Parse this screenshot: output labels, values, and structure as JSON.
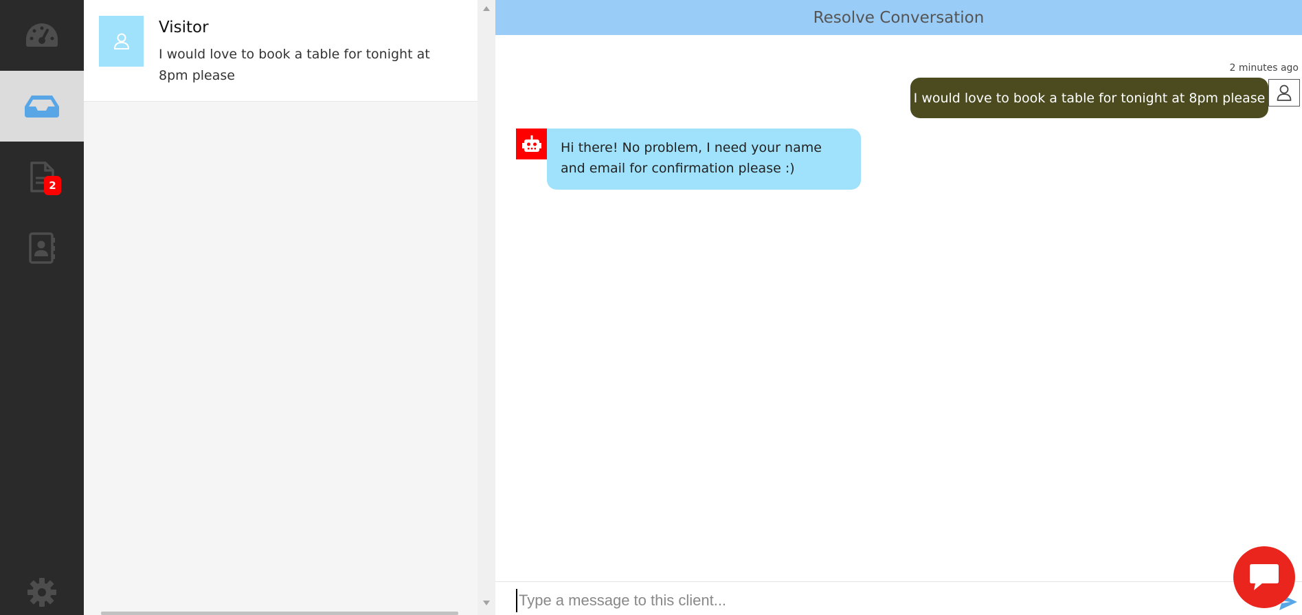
{
  "nav": {
    "items": [
      {
        "icon": "dashboard-gauge-icon"
      },
      {
        "icon": "inbox-icon",
        "active": true
      },
      {
        "icon": "document-icon",
        "badge": "2"
      },
      {
        "icon": "contact-book-icon"
      }
    ],
    "settings_icon": "gear-icon",
    "colors": {
      "rail": "#2a2a2a",
      "active_bg": "#dcdcdc",
      "active_icon": "#59a6e6",
      "icon": "#4d4d4d",
      "badge": "#ff0000"
    }
  },
  "conversations": [
    {
      "name": "Visitor",
      "preview": "I would love to book a table for tonight at 8pm please",
      "avatar_icon": "user-icon"
    }
  ],
  "chat": {
    "header_action": "Resolve Conversation",
    "messages": [
      {
        "direction": "out",
        "text": "I would love to book a table for tonight at 8pm please",
        "time": "2 minutes ago",
        "avatar_icon": "user-icon"
      },
      {
        "direction": "in",
        "text": "Hi there! No problem, I need your name and email for confirmation please :)",
        "avatar_icon": "robot-icon"
      }
    ],
    "composer": {
      "placeholder": "Type a message to this client..."
    },
    "colors": {
      "header": "#99ccf7",
      "out_bubble": "#4b4b1f",
      "in_bubble": "#a0e2fb",
      "bot_avatar": "#ff0000",
      "fab": "#e9251d"
    }
  }
}
